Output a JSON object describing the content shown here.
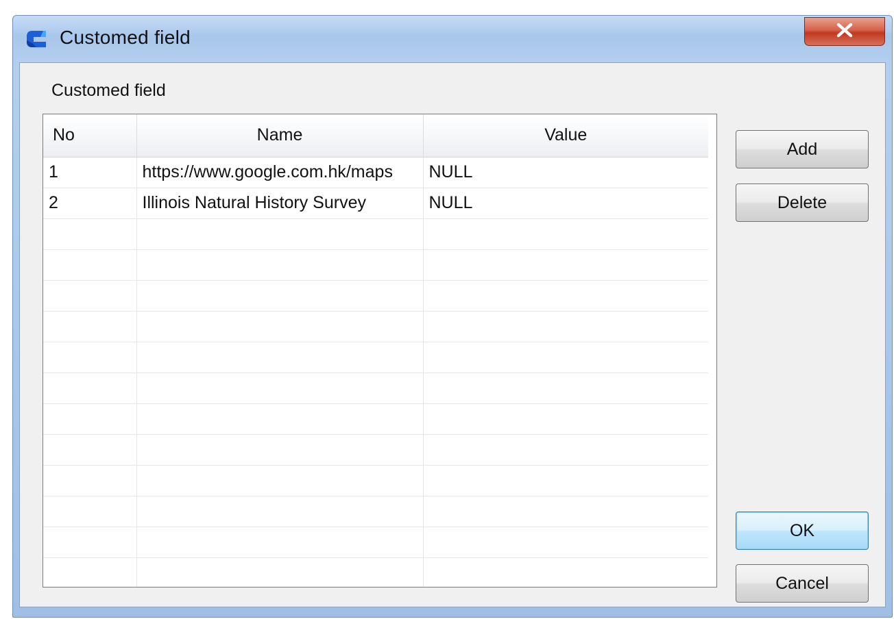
{
  "window": {
    "title": "Customed field",
    "close_glyph": "✕"
  },
  "group": {
    "label": "Customed field"
  },
  "table": {
    "columns": [
      "No",
      "Name",
      "Value"
    ],
    "rows": [
      [
        "1",
        "https://www.google.com.hk/maps",
        "NULL"
      ],
      [
        "2",
        "Illinois Natural History Survey",
        "NULL"
      ],
      [
        "",
        "",
        ""
      ],
      [
        "",
        "",
        ""
      ],
      [
        "",
        "",
        ""
      ],
      [
        "",
        "",
        ""
      ],
      [
        "",
        "",
        ""
      ],
      [
        "",
        "",
        ""
      ],
      [
        "",
        "",
        ""
      ],
      [
        "",
        "",
        ""
      ],
      [
        "",
        "",
        ""
      ],
      [
        "",
        "",
        ""
      ],
      [
        "",
        "",
        ""
      ],
      [
        "",
        "",
        ""
      ]
    ]
  },
  "buttons": {
    "add": "Add",
    "delete": "Delete",
    "ok": "OK",
    "cancel": "Cancel"
  },
  "colors": {
    "app_icon_blue": "#1d5fd6",
    "close_red": "#c7402a",
    "default_button": "#bee6fd"
  },
  "icons": {
    "app": "app-logo-icon",
    "close": "close-icon"
  }
}
